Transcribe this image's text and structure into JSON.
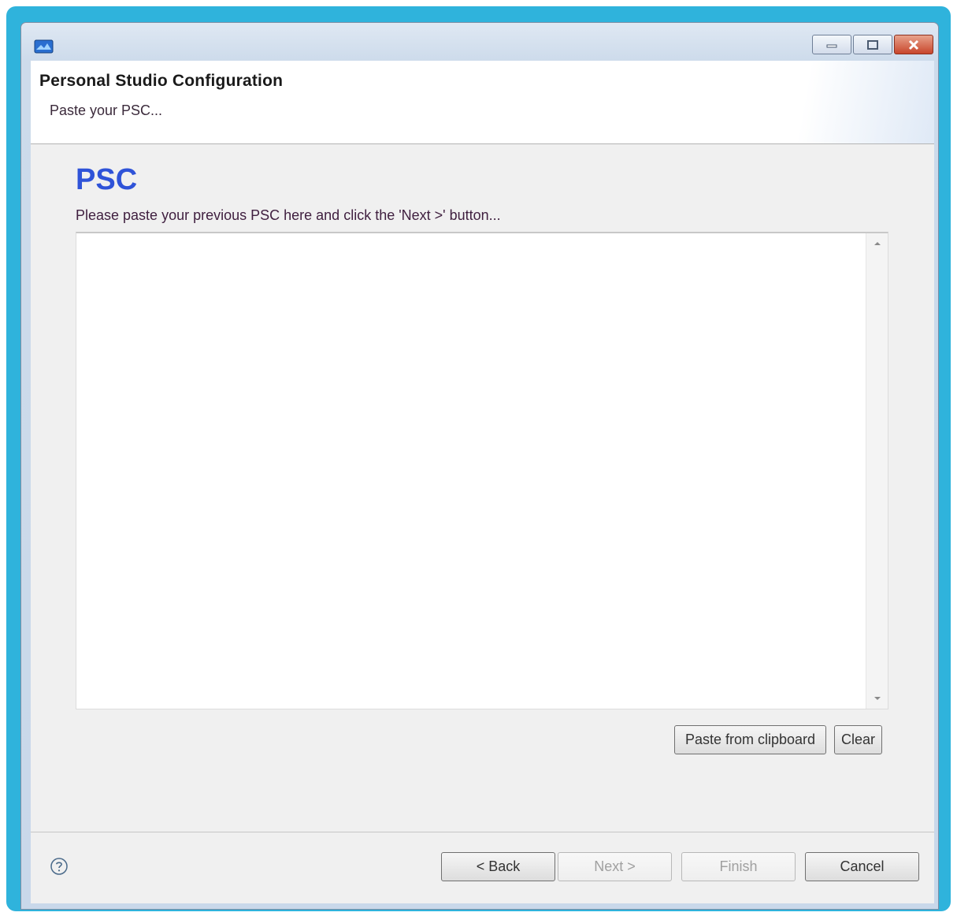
{
  "window": {
    "title": "",
    "controls": [
      "minimize-icon",
      "maximize-icon",
      "close-icon"
    ]
  },
  "header": {
    "title": "Personal Studio Configuration",
    "subtitle": "Paste your PSC..."
  },
  "main": {
    "section_title": "PSC",
    "instruction": "Please paste your previous PSC here and click the 'Next >' button...",
    "textarea_value": "",
    "paste_button": "Paste from clipboard",
    "clear_button": "Clear"
  },
  "footer": {
    "back_button": "< Back",
    "next_button": "Next >",
    "finish_button": "Finish",
    "cancel_button": "Cancel"
  },
  "colors": {
    "accent_title": "#2f53d8",
    "frame": "#2fb3dc",
    "close_button": "#c8452b"
  }
}
